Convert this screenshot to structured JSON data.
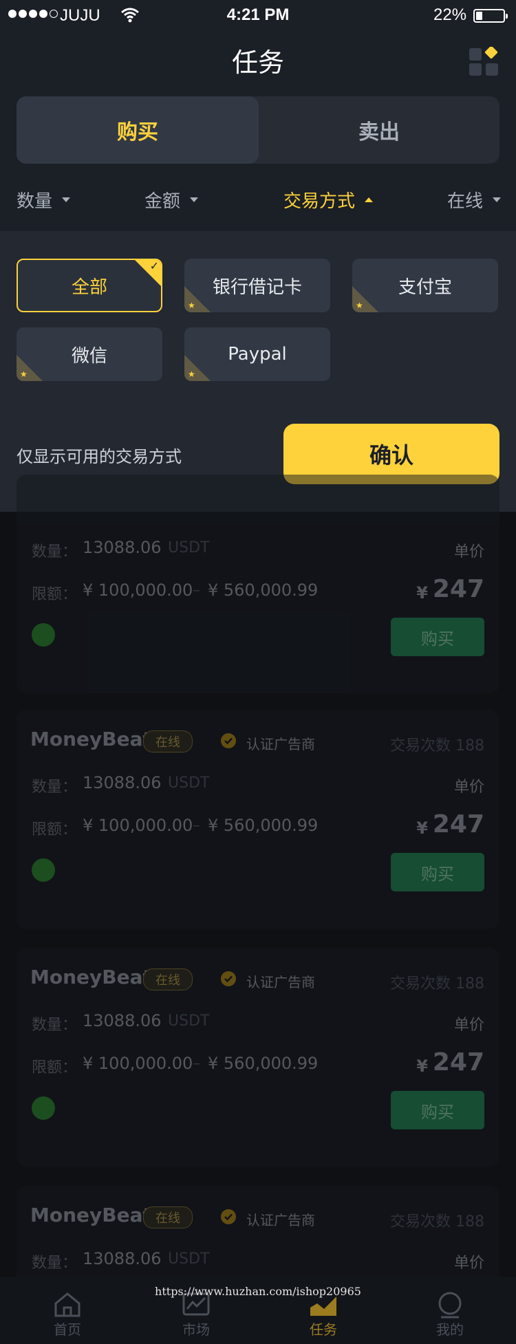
{
  "status_bar": {
    "carrier": "JUJU",
    "time": "4:21 PM",
    "battery": "22%"
  },
  "header": {
    "title": "任务"
  },
  "segment": {
    "buy": "购买",
    "sell": "卖出"
  },
  "filters": {
    "quantity": "数量",
    "amount": "金额",
    "method": "交易方式",
    "online": "在线"
  },
  "methods": {
    "all": "全部",
    "bank_card": "银行借记卡",
    "alipay": "支付宝",
    "wechat": "微信",
    "paypal": "Paypal"
  },
  "panel": {
    "note": "仅显示可用的交易方式",
    "confirm": "确认"
  },
  "colors": {
    "accent": "#fdd23b",
    "buy_button": "#1f8a52",
    "background": "#0e1014"
  },
  "card": {
    "name": "MoneyBeat",
    "online": "在线",
    "certified": "认证广告商",
    "trades": "交易次数 188",
    "qty_label": "数量：",
    "qty_value": "13088.06",
    "qty_unit": "USDT",
    "unit_price_label": "单价",
    "limit_label": "限额：",
    "limit_min": "¥ 100,000.00",
    "limit_sep": "–",
    "limit_max": "¥ 560,000.99",
    "currency": "¥",
    "price": "247",
    "buy_label": "购买"
  },
  "tab_bar": {
    "home": "首页",
    "market": "市场",
    "tasks": "任务",
    "mine": "我的"
  },
  "watermark": "https://www.huzhan.com/ishop20965"
}
